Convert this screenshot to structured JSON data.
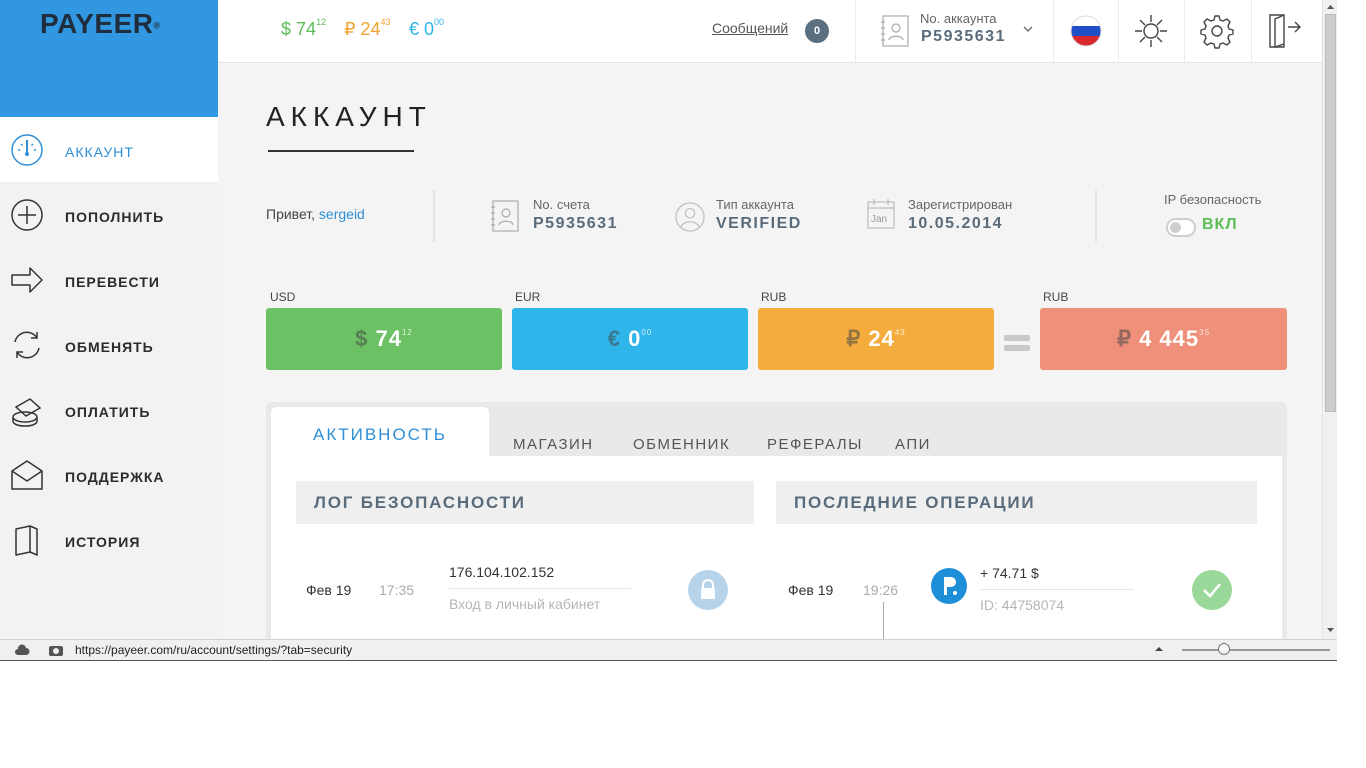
{
  "logo": {
    "text": "PAYEER",
    "reg": "®"
  },
  "topbar": {
    "balances": [
      {
        "symbol": "$",
        "main": "74",
        "cents": "12",
        "color": "#5cbf56"
      },
      {
        "symbol": "₽",
        "main": "24",
        "cents": "43",
        "color": "#f0a531"
      },
      {
        "symbol": "€",
        "main": "0",
        "cents": "00",
        "color": "#2fb5ea"
      }
    ],
    "messages_label": "Сообщений",
    "messages_count": "0",
    "account_label": "No. аккаунта",
    "account_number": "P5935631"
  },
  "sidebar": {
    "items": [
      {
        "label": "АККАУНТ",
        "icon": "gauge-icon"
      },
      {
        "label": "ПОПОЛНИТЬ",
        "icon": "plus-circle-icon"
      },
      {
        "label": "ПЕРЕВЕСТИ",
        "icon": "arrow-right-icon"
      },
      {
        "label": "ОБМЕНЯТЬ",
        "icon": "refresh-icon"
      },
      {
        "label": "ОПЛАТИТЬ",
        "icon": "coins-icon"
      },
      {
        "label": "ПОДДЕРЖКА",
        "icon": "envelope-icon"
      },
      {
        "label": "ИСТОРИЯ",
        "icon": "book-icon"
      }
    ],
    "collapse_icon": "arrow-left-icon"
  },
  "page": {
    "title": "АККАУНТ",
    "greeting": "Привет,",
    "username": "sergeid",
    "account_no_label": "No. счета",
    "account_no": "P5935631",
    "account_type_label": "Тип аккаунта",
    "account_type": "VERIFIED",
    "registered_label": "Зарегистрирован",
    "registered_icon_text": "Jan",
    "registered_date": "10.05.2014",
    "ip_security_label": "IP безопасность",
    "ip_security_value": "ВКЛ"
  },
  "cards": [
    {
      "currency": "USD",
      "symbol": "$",
      "main": "74",
      "cents": "12",
      "color": "#6cc164"
    },
    {
      "currency": "EUR",
      "symbol": "€",
      "main": "0",
      "cents": "00",
      "color": "#2fb5ea"
    },
    {
      "currency": "RUB",
      "symbol": "₽",
      "main": "24",
      "cents": "43",
      "color": "#f4ad3d"
    },
    {
      "currency": "RUB",
      "symbol": "₽",
      "main": "4 445",
      "cents": "35",
      "color": "#ef917a"
    }
  ],
  "tabs": [
    "АКТИВНОСТЬ",
    "МАГАЗИН",
    "ОБМЕННИК",
    "РЕФЕРАЛЫ",
    "АПИ"
  ],
  "security_log": {
    "heading": "ЛОГ БЕЗОПАСНОСТИ",
    "rows": [
      {
        "date": "Фев 19",
        "time": "17:35",
        "ip": "176.104.102.152",
        "desc": "Вход в личный кабинет"
      }
    ]
  },
  "operations": {
    "heading": "ПОСЛЕДНИЕ ОПЕРАЦИИ",
    "rows": [
      {
        "date": "Фев 19",
        "time": "19:26",
        "amount": "+ 74.71 $",
        "id": "ID: 44758074"
      }
    ]
  },
  "statusbar": {
    "url": "https://payeer.com/ru/account/settings/?tab=security"
  }
}
